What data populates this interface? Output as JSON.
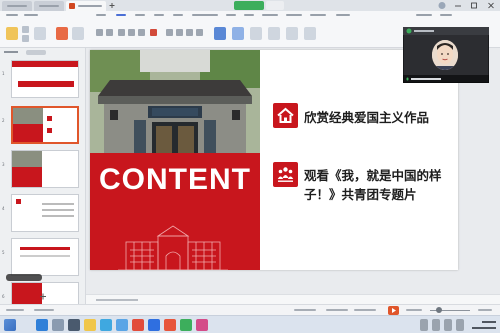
{
  "slide": {
    "title_word": "CONTENT",
    "items": [
      {
        "text": "欣赏经典爱国主义作品",
        "icon": "house-icon"
      },
      {
        "text": "观看《我，就是中国的样子！》共青团专题片",
        "icon": "people-group-icon"
      }
    ]
  },
  "colors": {
    "accent_red": "#c8161d",
    "wps_orange": "#e0562b",
    "meeting_green": "#3cae5c"
  }
}
